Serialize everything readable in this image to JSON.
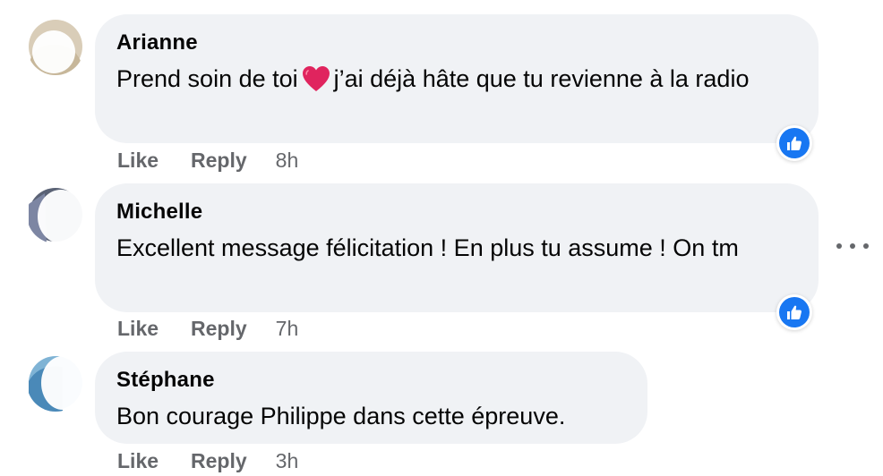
{
  "comments": [
    {
      "author": "Arianne",
      "text_before_emoji": "Prend soin de toi",
      "emoji": "red-heart",
      "text_after_emoji": "j’ai déjà hâte que tu revienne à la radio",
      "actions": {
        "like": "Like",
        "reply": "Reply",
        "time": "8h"
      },
      "reaction": "like-icon"
    },
    {
      "author": "Michelle",
      "text": "Excellent message félicitation ! En plus tu assume ! On tm",
      "actions": {
        "like": "Like",
        "reply": "Reply",
        "time": "7h"
      },
      "reaction": "like-icon"
    },
    {
      "author": "Stéphane",
      "text": "Bon courage Philippe dans cette épreuve.",
      "actions": {
        "like": "Like",
        "reply": "Reply",
        "time": "3h"
      }
    }
  ],
  "colors": {
    "bubble": "#f0f2f5",
    "secondary_text": "#65676b",
    "like_blue": "#1877f2",
    "heart_red": "#e0245e"
  },
  "icons": [
    "more-options-icon",
    "like-reaction-icon",
    "red-heart-emoji"
  ]
}
